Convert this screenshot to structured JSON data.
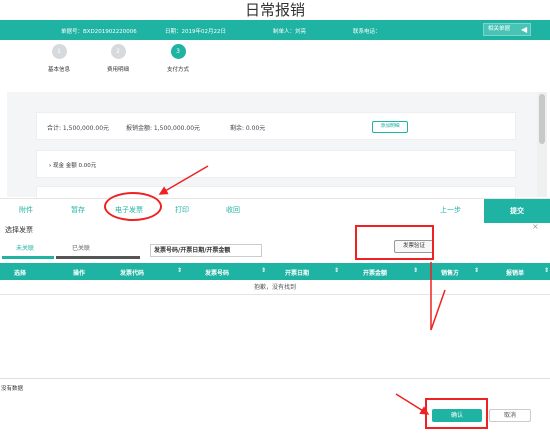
{
  "title": "日常报销",
  "info": {
    "doc_no": "单据号：BXD201902220006",
    "date": "日期：2019年02月22日",
    "creator": "制单人：刘亮",
    "contact": "联系电话：",
    "related_docs": "相关单据"
  },
  "steps": [
    {
      "num": "1",
      "label": "基本信息"
    },
    {
      "num": "2",
      "label": "费用明细"
    },
    {
      "num": "3",
      "label": "支付方式"
    }
  ],
  "summary": {
    "total": "合计: 1,500,000.00元",
    "reimbursed": "报销金额: 1,500,000.00元",
    "remaining": "剩余: 0.00元",
    "add_detail": "添加明细"
  },
  "cash_line": "现金  金额 0.00元",
  "toolbar": {
    "attachment": "附件",
    "save_draft": "暂存",
    "e_invoice": "电子发票",
    "print": "打印",
    "withdraw": "收回",
    "prev_step": "上一步",
    "submit": "提交"
  },
  "dialog": {
    "title": "选择发票",
    "close": "×",
    "tab_unlinked": "未关联",
    "tab_linked": "已关联",
    "search_placeholder": "发票号码/开票日期/开票金额",
    "verify_button": "发票验证",
    "columns": [
      "选择",
      "操作",
      "发票代码",
      "发票号码",
      "开票日期",
      "开票金额",
      "销售方",
      "报销单"
    ],
    "empty_text": "抱歉，没有找到",
    "no_data": "没有数据",
    "confirm": "确认",
    "cancel": "取消"
  },
  "colors": {
    "accent": "#1fb3a3",
    "highlight": "#e22222"
  }
}
